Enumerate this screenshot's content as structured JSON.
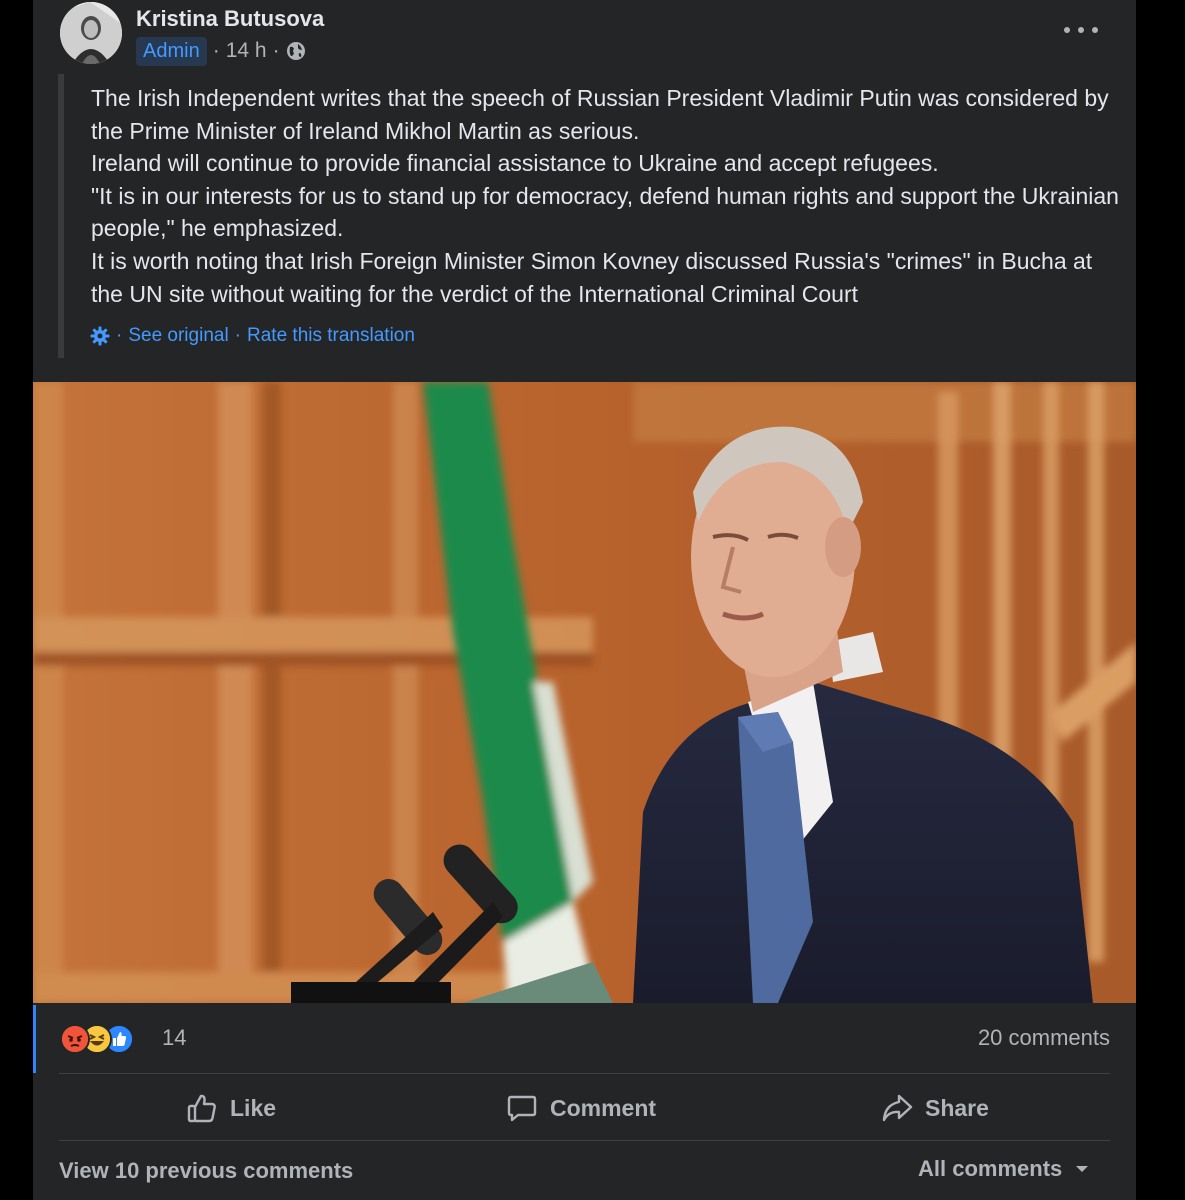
{
  "post": {
    "author": "Kristina Butusova",
    "role_badge": "Admin",
    "separator": "·",
    "time": "14 h",
    "privacy_icon": "globe-icon",
    "more_icon": "more-options-icon",
    "paragraphs": [
      "The Irish Independent writes that the speech of Russian President Vladimir Putin was considered by the Prime Minister of Ireland Mikhol Martin as serious.",
      "Ireland will continue to provide financial assistance to Ukraine and accept refugees.",
      "\"It is in our interests for us to stand up for democracy, defend human rights and support the Ukrainian people,\" he emphasized.",
      "It is worth noting that Irish Foreign Minister Simon Kovney discussed Russia's \"crimes\" in Bucha at the UN site without waiting for the verdict of the International Criminal Court"
    ],
    "translation": {
      "icon": "gear-icon",
      "separator": "·",
      "see_original": "See original",
      "rate_translation": "Rate this translation"
    }
  },
  "reactions": {
    "icons": [
      "angry-reaction-icon",
      "haha-reaction-icon",
      "like-reaction-icon"
    ],
    "count": "14",
    "comments": "20 comments"
  },
  "actions": {
    "like": "Like",
    "comment": "Comment",
    "share": "Share"
  },
  "comments_section": {
    "view_previous": "View 10 previous comments",
    "filter": "All comments"
  },
  "colors": {
    "card_bg": "#242526",
    "page_bg": "#000000",
    "text_primary": "#e4e6eb",
    "text_secondary": "#b0b3b8",
    "link_blue": "#4599ff",
    "badge_bg": "#263951"
  }
}
